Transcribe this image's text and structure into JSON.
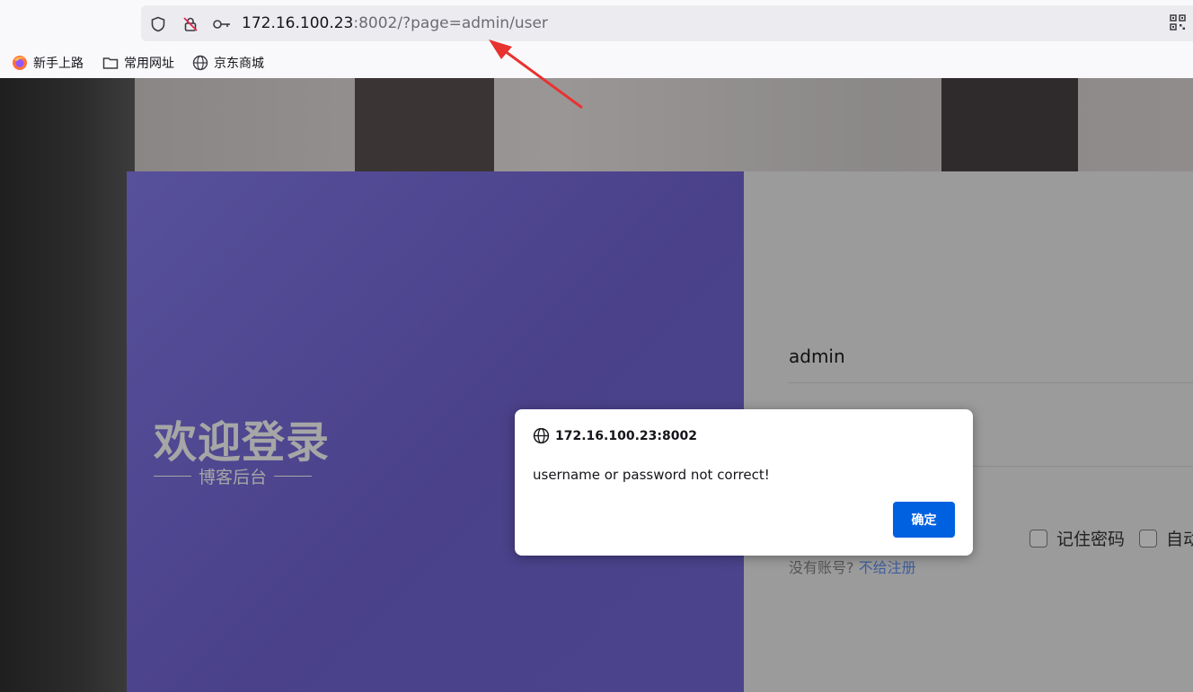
{
  "browser": {
    "url_host": "172.16.100.23",
    "url_rest": ":8002/?page=admin/user",
    "bookmarks": [
      {
        "label": "新手上路",
        "icon": "firefox-icon"
      },
      {
        "label": "常用网址",
        "icon": "folder-icon"
      },
      {
        "label": "京东商城",
        "icon": "globe-icon"
      }
    ]
  },
  "login": {
    "welcome": "欢迎登录",
    "subtitle": "博客后台",
    "username_value": "admin",
    "remember_label": "记住密码",
    "auto_label": "自动",
    "no_account": "没有账号?",
    "register_link": "不给注册"
  },
  "dialog": {
    "origin": "172.16.100.23:8002",
    "message": "username or password not correct!",
    "ok_label": "确定"
  },
  "colors": {
    "accent_button": "#0061e0",
    "left_panel": "#4a418a",
    "annotation_arrow": "#e8322f"
  }
}
